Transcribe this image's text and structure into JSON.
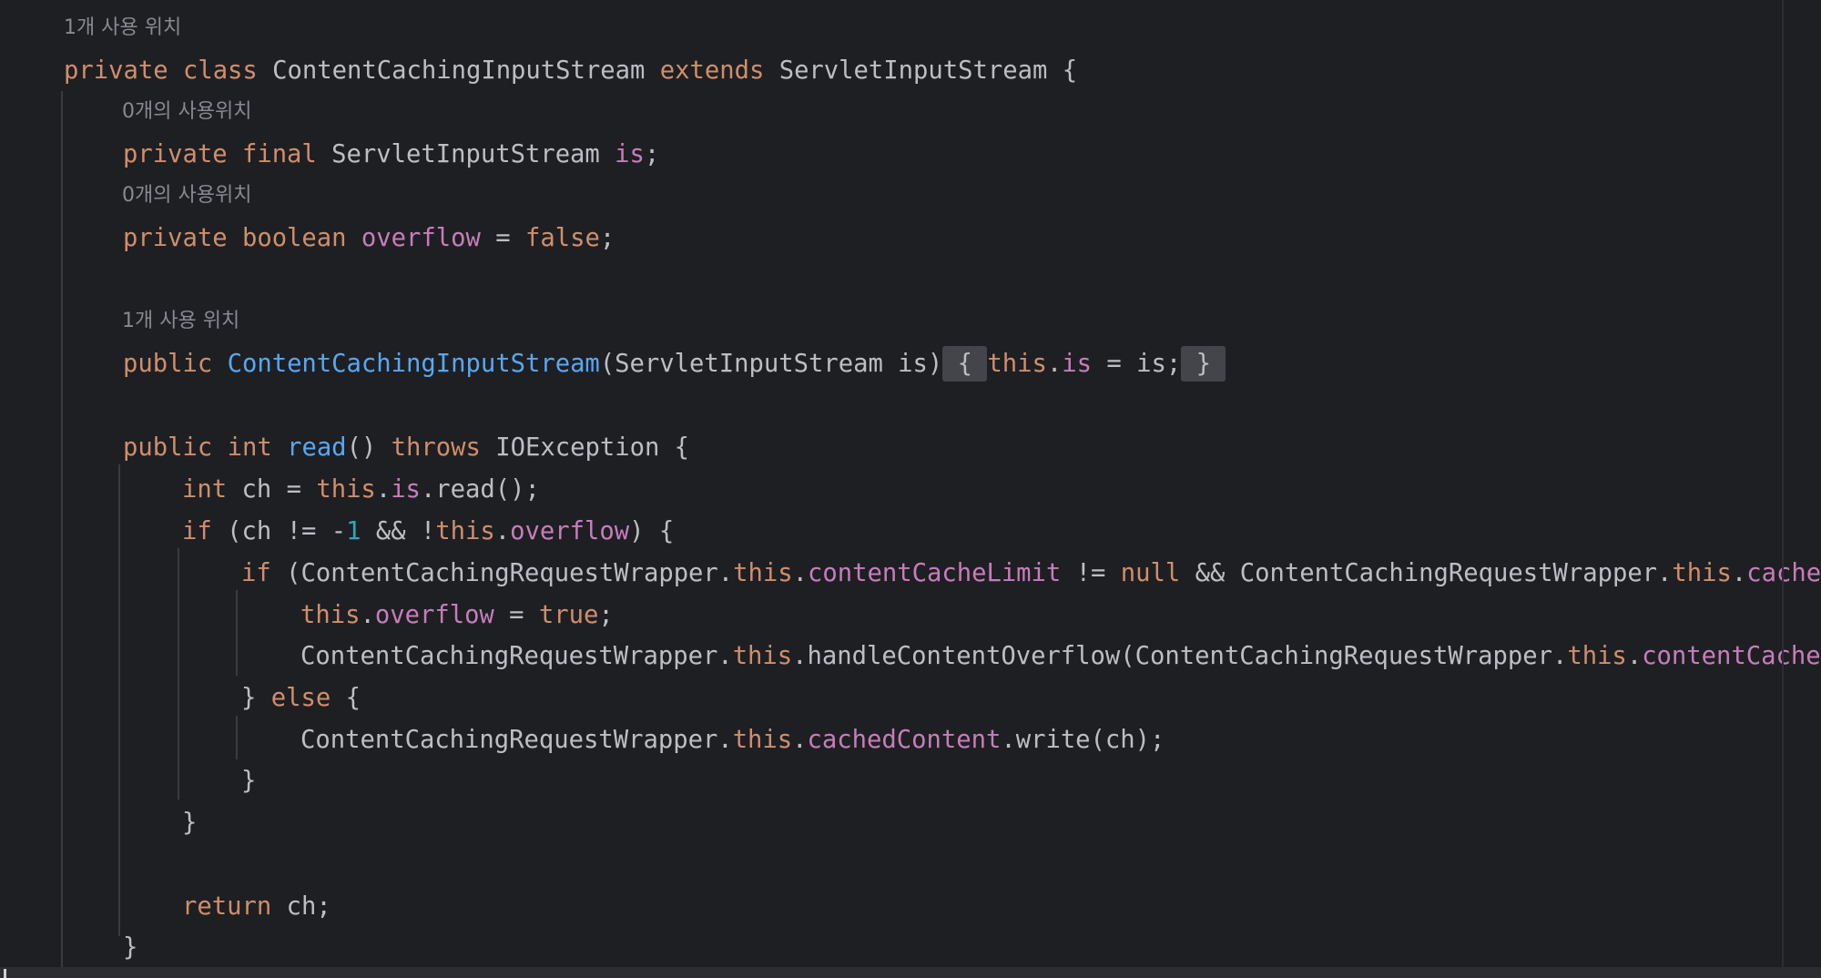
{
  "editor": {
    "colors": {
      "background": "#1e1f22",
      "text": "#bcbec4",
      "keyword": "#cf8e6d",
      "method_declaration": "#56a8f5",
      "field": "#c77dbb",
      "number": "#2aacb8",
      "inlay_hint": "#868a91",
      "brace_fold_highlight": "#43454a"
    },
    "hints": [
      "1개 사용 위치",
      "0개의 사용위치",
      "0개의 사용위치",
      "1개 사용 위치"
    ],
    "lines": [
      {
        "tokens": [
          {
            "t": "private",
            "k": "kw"
          },
          {
            "t": " "
          },
          {
            "t": "class",
            "k": "kw"
          },
          {
            "t": " ContentCachingInputStream "
          },
          {
            "t": "extends",
            "k": "kw"
          },
          {
            "t": " ServletInputStream {"
          }
        ]
      },
      {
        "tokens": [
          {
            "t": "private",
            "k": "kw"
          },
          {
            "t": " "
          },
          {
            "t": "final",
            "k": "kw"
          },
          {
            "t": " ServletInputStream "
          },
          {
            "t": "is",
            "k": "fld"
          },
          {
            "t": ";"
          }
        ]
      },
      {
        "tokens": [
          {
            "t": "private",
            "k": "kw"
          },
          {
            "t": " "
          },
          {
            "t": "boolean",
            "k": "kw"
          },
          {
            "t": " "
          },
          {
            "t": "overflow",
            "k": "fld"
          },
          {
            "t": " = "
          },
          {
            "t": "false",
            "k": "kw"
          },
          {
            "t": ";"
          }
        ]
      },
      {
        "tokens": [
          {
            "t": "public",
            "k": "kw"
          },
          {
            "t": " "
          },
          {
            "t": "ContentCachingInputStream",
            "k": "fn"
          },
          {
            "t": "(ServletInputStream is)"
          },
          {
            "t": " { ",
            "k": "br"
          },
          {
            "t": "this",
            "k": "kw"
          },
          {
            "t": "."
          },
          {
            "t": "is",
            "k": "fld"
          },
          {
            "t": " = is;"
          },
          {
            "t": " } ",
            "k": "br"
          }
        ]
      },
      {
        "tokens": [
          {
            "t": "public",
            "k": "kw"
          },
          {
            "t": " "
          },
          {
            "t": "int",
            "k": "kw"
          },
          {
            "t": " "
          },
          {
            "t": "read",
            "k": "fn"
          },
          {
            "t": "() "
          },
          {
            "t": "throws",
            "k": "kw"
          },
          {
            "t": " IOException {"
          }
        ]
      },
      {
        "tokens": [
          {
            "t": "int",
            "k": "kw"
          },
          {
            "t": " ch = "
          },
          {
            "t": "this",
            "k": "kw"
          },
          {
            "t": "."
          },
          {
            "t": "is",
            "k": "fld"
          },
          {
            "t": ".read();"
          }
        ]
      },
      {
        "tokens": [
          {
            "t": "if",
            "k": "kw"
          },
          {
            "t": " (ch != -"
          },
          {
            "t": "1",
            "k": "num"
          },
          {
            "t": " && !"
          },
          {
            "t": "this",
            "k": "kw"
          },
          {
            "t": "."
          },
          {
            "t": "overflow",
            "k": "fld"
          },
          {
            "t": ") {"
          }
        ]
      },
      {
        "tokens": [
          {
            "t": "if",
            "k": "kw"
          },
          {
            "t": " (ContentCachingRequestWrapper."
          },
          {
            "t": "this",
            "k": "kw"
          },
          {
            "t": "."
          },
          {
            "t": "contentCacheLimit",
            "k": "fld"
          },
          {
            "t": " != "
          },
          {
            "t": "null",
            "k": "kw"
          },
          {
            "t": " && ContentCachingRequestWrapper."
          },
          {
            "t": "this",
            "k": "kw"
          },
          {
            "t": "."
          },
          {
            "t": "cachedC",
            "k": "fld"
          }
        ]
      },
      {
        "tokens": [
          {
            "t": "this",
            "k": "kw"
          },
          {
            "t": "."
          },
          {
            "t": "overflow",
            "k": "fld"
          },
          {
            "t": " = "
          },
          {
            "t": "true",
            "k": "kw"
          },
          {
            "t": ";"
          }
        ]
      },
      {
        "tokens": [
          {
            "t": "ContentCachingRequestWrapper."
          },
          {
            "t": "this",
            "k": "kw"
          },
          {
            "t": ".handleContentOverflow(ContentCachingRequestWrapper."
          },
          {
            "t": "this",
            "k": "kw"
          },
          {
            "t": "."
          },
          {
            "t": "contentCacheL",
            "k": "fld"
          }
        ]
      },
      {
        "tokens": [
          {
            "t": "} "
          },
          {
            "t": "else",
            "k": "kw"
          },
          {
            "t": " {"
          }
        ]
      },
      {
        "tokens": [
          {
            "t": "ContentCachingRequestWrapper."
          },
          {
            "t": "this",
            "k": "kw"
          },
          {
            "t": "."
          },
          {
            "t": "cachedContent",
            "k": "fld"
          },
          {
            "t": ".write(ch);"
          }
        ]
      },
      {
        "tokens": [
          {
            "t": "}"
          }
        ]
      },
      {
        "tokens": [
          {
            "t": "}"
          }
        ]
      },
      {
        "tokens": [
          {
            "t": "return",
            "k": "kw"
          },
          {
            "t": " ch;"
          }
        ]
      },
      {
        "tokens": [
          {
            "t": "}"
          }
        ]
      }
    ]
  }
}
